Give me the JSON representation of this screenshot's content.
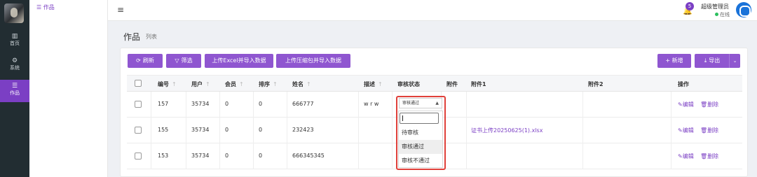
{
  "sidebar": {
    "items": [
      {
        "label": "首页",
        "icon": "bar-chart-icon"
      },
      {
        "label": "系统",
        "icon": "gear-icon"
      },
      {
        "label": "作品",
        "icon": "list-icon"
      }
    ]
  },
  "submenu": {
    "item": "作品"
  },
  "header": {
    "notifications": "5",
    "username": "超级管理员",
    "status": "在线"
  },
  "page": {
    "title": "作品",
    "subtitle": "列表"
  },
  "toolbar": {
    "refresh": "刷新",
    "filter": "筛选",
    "import_excel": "上传Excel并导入数据",
    "import_zip": "上传压缩包并导入数据",
    "add": "+ 新增",
    "export": "导出"
  },
  "table": {
    "headers": {
      "id": "编号",
      "user": "用户",
      "member": "会员",
      "sort": "排序",
      "name": "姓名",
      "desc": "描述",
      "review": "审核状态",
      "attach": "附件",
      "attach1": "附件1",
      "attach2": "附件2",
      "ops": "操作"
    },
    "rows": [
      {
        "id": "157",
        "user": "35734",
        "member": "0",
        "sort": "0",
        "name": "666777",
        "desc": "w r w",
        "attach1": "",
        "edit": "编辑",
        "del": "删除"
      },
      {
        "id": "155",
        "user": "35734",
        "member": "0",
        "sort": "0",
        "name": "232423",
        "desc": "",
        "attach1": "证书上传20250625(1).xlsx",
        "edit": "编辑",
        "del": "删除"
      },
      {
        "id": "153",
        "user": "35734",
        "member": "0",
        "sort": "0",
        "name": "666345345",
        "desc": "",
        "attach1": "",
        "edit": "编辑",
        "del": "删除"
      }
    ]
  },
  "review_select": {
    "selected": "审核通过",
    "search_value": "",
    "options": [
      "待审核",
      "审核通过",
      "审核不通过"
    ],
    "highlighted_index": 1
  },
  "colors": {
    "accent": "#8f56d0",
    "sidebar_bg": "#222d32",
    "highlight_border": "#e0403a"
  }
}
